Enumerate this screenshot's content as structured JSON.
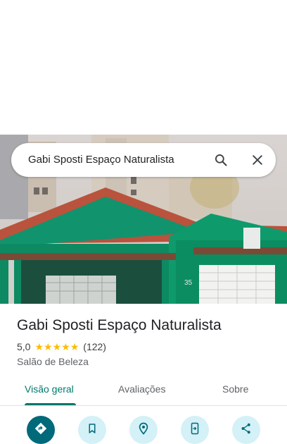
{
  "search": {
    "query": "Gabi Sposti Espaço Naturalista"
  },
  "place": {
    "name": "Gabi Sposti Espaço Naturalista",
    "rating": "5,0",
    "review_count": "(122)",
    "category": "Salão de Beleza",
    "stars": 5
  },
  "tabs": [
    {
      "label": "Visão geral",
      "active": true
    },
    {
      "label": "Avaliações",
      "active": false
    },
    {
      "label": "Sobre",
      "active": false
    }
  ],
  "actions": [
    {
      "icon": "directions-icon"
    },
    {
      "icon": "save-bookmark-icon"
    },
    {
      "icon": "nearby-icon"
    },
    {
      "icon": "send-to-phone-icon"
    },
    {
      "icon": "share-icon"
    }
  ],
  "colors": {
    "accent": "#00796b",
    "star": "#fbbc04",
    "action_bg": "#d3f1f7",
    "primary_action": "#00697a"
  }
}
